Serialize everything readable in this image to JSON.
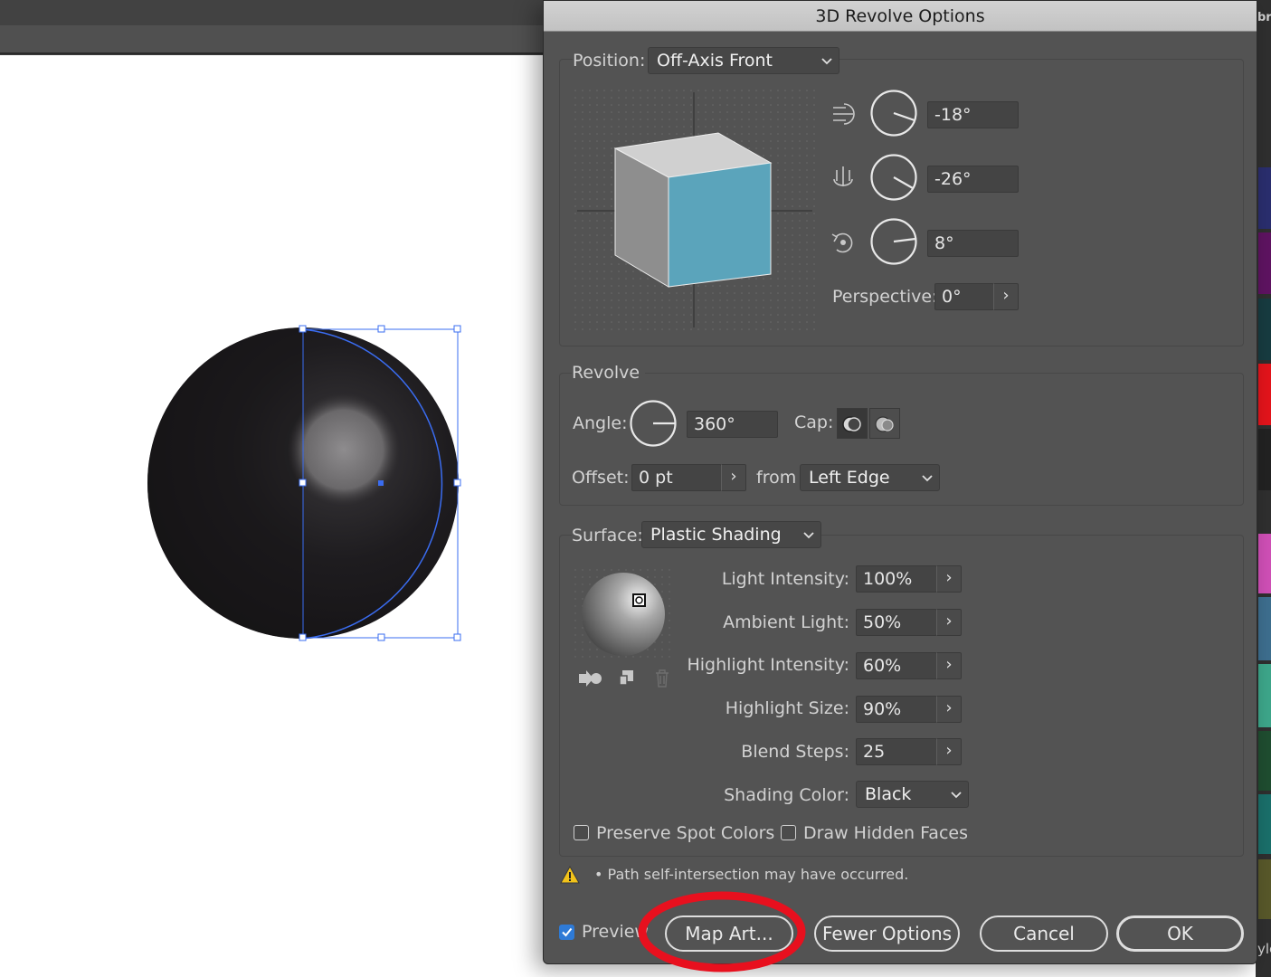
{
  "app": {
    "top_right_peek": "br",
    "bottom_right_peek": "yle"
  },
  "dialog": {
    "title": "3D Revolve Options",
    "position": {
      "label": "Position:",
      "value": "Off-Axis Front",
      "x_rotation": "-18°",
      "y_rotation": "-26°",
      "z_rotation": "8°",
      "perspective_label": "Perspective:",
      "perspective_value": "0°"
    },
    "revolve": {
      "section_label": "Revolve",
      "angle_label": "Angle:",
      "angle_value": "360°",
      "cap_label": "Cap:",
      "offset_label": "Offset:",
      "offset_value": "0 pt",
      "from_label": "from",
      "from_value": "Left Edge"
    },
    "surface": {
      "label": "Surface:",
      "value": "Plastic Shading",
      "light_intensity_label": "Light Intensity:",
      "light_intensity_value": "100%",
      "ambient_light_label": "Ambient Light:",
      "ambient_light_value": "50%",
      "highlight_intensity_label": "Highlight Intensity:",
      "highlight_intensity_value": "60%",
      "highlight_size_label": "Highlight Size:",
      "highlight_size_value": "90%",
      "blend_steps_label": "Blend Steps:",
      "blend_steps_value": "25",
      "shading_color_label": "Shading Color:",
      "shading_color_value": "Black",
      "preserve_spot_colors_label": "Preserve Spot Colors",
      "draw_hidden_faces_label": "Draw Hidden Faces"
    },
    "warning_text": "• Path self-intersection may have occurred.",
    "footer": {
      "preview_label": "Preview",
      "preview_checked": true,
      "map_art_label": "Map Art...",
      "fewer_options_label": "Fewer Options",
      "cancel_label": "Cancel",
      "ok_label": "OK"
    }
  },
  "colors": {
    "cube_front": "#5ba4bb",
    "annotation_circle": "#e8101e",
    "selection": "#3a6cf0",
    "preview_check": "#2e7ad6"
  }
}
